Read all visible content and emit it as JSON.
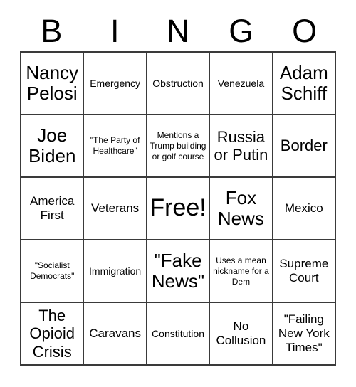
{
  "card": {
    "header_letters": [
      "B",
      "I",
      "N",
      "G",
      "O"
    ],
    "columns": 5,
    "rows": 5,
    "border_color": "#3a3a3a",
    "background_color": "#ffffff",
    "text_color": "#000000",
    "cells": [
      [
        {
          "text": "Nancy Pelosi",
          "size": "xl"
        },
        {
          "text": "Emergency",
          "size": "sm"
        },
        {
          "text": "Obstruction",
          "size": "sm"
        },
        {
          "text": "Venezuela",
          "size": "sm"
        },
        {
          "text": "Adam Schiff",
          "size": "xl"
        }
      ],
      [
        {
          "text": "Joe Biden",
          "size": "xl"
        },
        {
          "text": "\"The Party of Healthcare\"",
          "size": "xs"
        },
        {
          "text": "Mentions a Trump building or golf course",
          "size": "xs"
        },
        {
          "text": "Russia or Putin",
          "size": "lg"
        },
        {
          "text": "Border",
          "size": "lg"
        }
      ],
      [
        {
          "text": "America First",
          "size": "md"
        },
        {
          "text": "Veterans",
          "size": "md"
        },
        {
          "text": "Free!",
          "size": "xxl"
        },
        {
          "text": "Fox News",
          "size": "xl"
        },
        {
          "text": "Mexico",
          "size": "md"
        }
      ],
      [
        {
          "text": "\"Socialist Democrats\"",
          "size": "xs"
        },
        {
          "text": "Immigration",
          "size": "sm"
        },
        {
          "text": "\"Fake News\"",
          "size": "xl"
        },
        {
          "text": "Uses a mean nickname for a Dem",
          "size": "xs"
        },
        {
          "text": "Supreme Court",
          "size": "md"
        }
      ],
      [
        {
          "text": "The Opioid Crisis",
          "size": "lg"
        },
        {
          "text": "Caravans",
          "size": "md"
        },
        {
          "text": "Constitution",
          "size": "sm"
        },
        {
          "text": "No Collusion",
          "size": "md"
        },
        {
          "text": "\"Failing New York Times\"",
          "size": "md"
        }
      ]
    ]
  }
}
